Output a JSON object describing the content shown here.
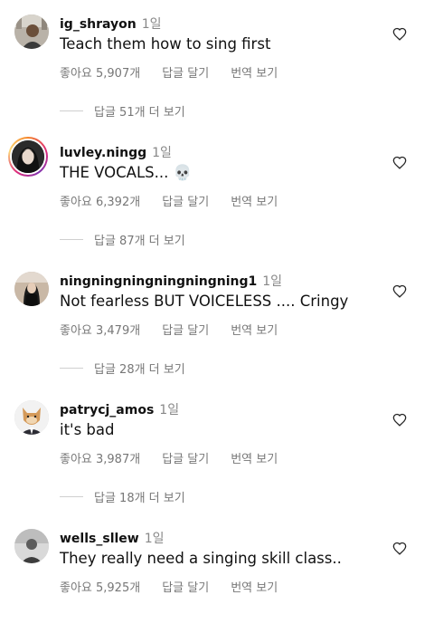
{
  "comments": [
    {
      "username": "ig_shrayon",
      "time": "1일",
      "text": "Teach them how to sing first",
      "likes": "좋아요 5,907개",
      "reply": "답글 달기",
      "translate": "번역 보기",
      "view_replies": "답글 51개 더 보기"
    },
    {
      "username": "luvley.ningg",
      "time": "1일",
      "text": "THE VOCALS... 💀",
      "likes": "좋아요 6,392개",
      "reply": "답글 달기",
      "translate": "번역 보기",
      "view_replies": "답글 87개 더 보기"
    },
    {
      "username": "ningningningningningning1",
      "time": "1일",
      "text": "Not fearless BUT VOICELESS .... Cringy",
      "likes": "좋아요 3,479개",
      "reply": "답글 달기",
      "translate": "번역 보기",
      "view_replies": "답글 28개 더 보기"
    },
    {
      "username": "patrycj_amos",
      "time": "1일",
      "text": "it's bad",
      "likes": "좋아요 3,987개",
      "reply": "답글 달기",
      "translate": "번역 보기",
      "view_replies": "답글 18개 더 보기"
    },
    {
      "username": "wells_sllew",
      "time": "1일",
      "text": "They really need a singing skill class..",
      "likes": "좋아요 5,925개",
      "reply": "답글 달기",
      "translate": "번역 보기"
    }
  ]
}
